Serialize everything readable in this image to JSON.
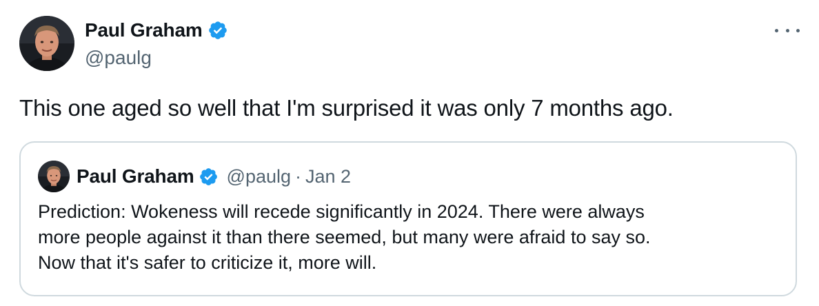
{
  "tweet": {
    "author": {
      "display_name": "Paul Graham",
      "handle": "@paulg",
      "verified_icon": "verified-badge-icon"
    },
    "more_icon": "more-options-icon",
    "text": "This one aged so well that I'm surprised it was only 7 months ago.",
    "quoted": {
      "author": {
        "display_name": "Paul Graham",
        "handle": "@paulg",
        "verified_icon": "verified-badge-icon"
      },
      "separator": "·",
      "date": "Jan 2",
      "text_lines": [
        "Prediction: Wokeness will recede significantly in 2024. There were always",
        "more people against it than there seemed, but many were afraid to say so.",
        "Now that it's safer to criticize it, more will."
      ]
    }
  },
  "colors": {
    "text_primary": "#0f1419",
    "text_secondary": "#536471",
    "verified_blue": "#1d9bf0",
    "border": "#cfd9de"
  }
}
